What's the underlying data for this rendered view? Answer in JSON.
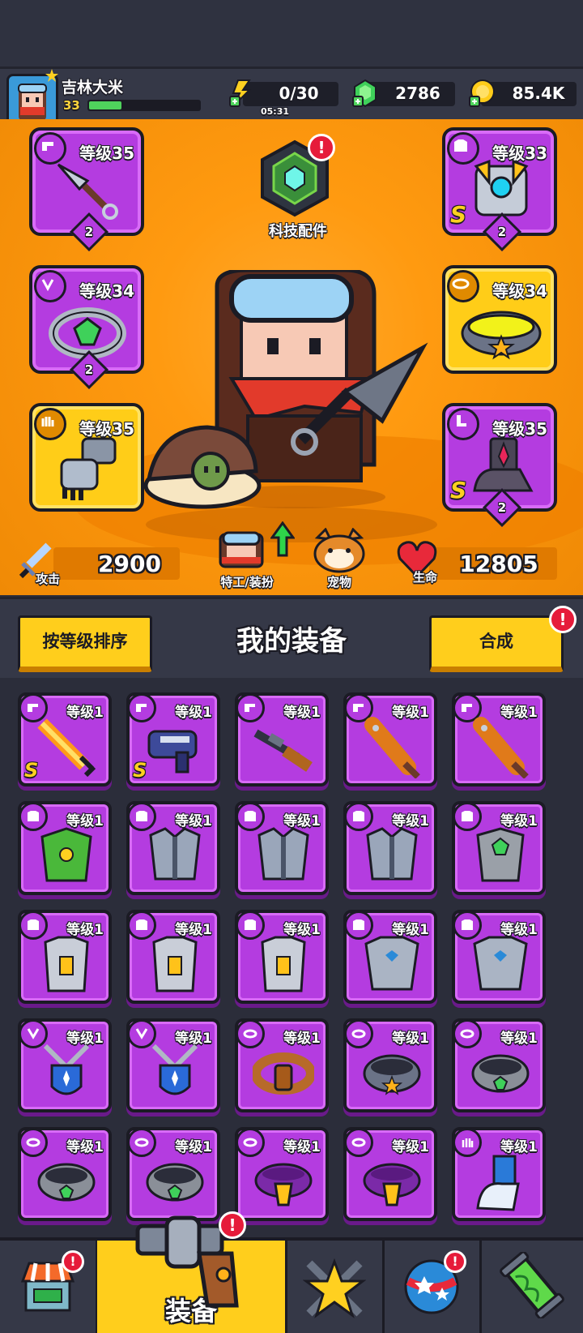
{
  "player": {
    "name": "吉林大米",
    "level": "33"
  },
  "resources": {
    "energy": "0/30",
    "energy_timer": "05:31",
    "gems": "2786",
    "coins": "85.4K"
  },
  "tech": {
    "label": "科技配件"
  },
  "slots": {
    "weapon": {
      "level": "等级35",
      "stars": "2"
    },
    "armor": {
      "level": "等级33",
      "stars": "2",
      "grade": "S"
    },
    "ring": {
      "level": "等级34",
      "stars": "2"
    },
    "belt": {
      "level": "等级34"
    },
    "gloves": {
      "level": "等级35"
    },
    "boots": {
      "level": "等级35",
      "stars": "2",
      "grade": "S"
    }
  },
  "stats": {
    "attack_label": "攻击",
    "attack": "2900",
    "hp_label": "生命",
    "hp": "12805",
    "agent_label": "特工/装扮",
    "pet_label": "宠物"
  },
  "equipment": {
    "title": "我的装备",
    "sort_button": "按等级排序",
    "merge_button": "合成",
    "items": [
      {
        "level": "等级1",
        "type": "weapon",
        "art": "sword",
        "grade": "S"
      },
      {
        "level": "等级1",
        "type": "weapon",
        "art": "blaster",
        "grade": "S"
      },
      {
        "level": "等级1",
        "type": "weapon",
        "art": "shotgun",
        "grade": ""
      },
      {
        "level": "等级1",
        "type": "weapon",
        "art": "bat",
        "grade": ""
      },
      {
        "level": "等级1",
        "type": "weapon",
        "art": "bat",
        "grade": ""
      },
      {
        "level": "等级1",
        "type": "armor",
        "art": "leaf-armor",
        "grade": ""
      },
      {
        "level": "等级1",
        "type": "armor",
        "art": "plate-armor",
        "grade": ""
      },
      {
        "level": "等级1",
        "type": "armor",
        "art": "plate-armor",
        "grade": ""
      },
      {
        "level": "等级1",
        "type": "armor",
        "art": "plate-armor",
        "grade": ""
      },
      {
        "level": "等级1",
        "type": "armor",
        "art": "gem-armor",
        "grade": ""
      },
      {
        "level": "等级1",
        "type": "armor",
        "art": "vest",
        "grade": ""
      },
      {
        "level": "等级1",
        "type": "armor",
        "art": "vest",
        "grade": ""
      },
      {
        "level": "等级1",
        "type": "armor",
        "art": "vest",
        "grade": ""
      },
      {
        "level": "等级1",
        "type": "armor",
        "art": "chestplate",
        "grade": ""
      },
      {
        "level": "等级1",
        "type": "armor",
        "art": "chestplate",
        "grade": ""
      },
      {
        "level": "等级1",
        "type": "necklace",
        "art": "shield-necklace",
        "grade": ""
      },
      {
        "level": "等级1",
        "type": "necklace",
        "art": "shield-necklace",
        "grade": ""
      },
      {
        "level": "等级1",
        "type": "belt",
        "art": "rope-belt",
        "grade": ""
      },
      {
        "level": "等级1",
        "type": "belt",
        "art": "star-belt",
        "grade": ""
      },
      {
        "level": "等级1",
        "type": "belt",
        "art": "gem-belt",
        "grade": ""
      },
      {
        "level": "等级1",
        "type": "belt",
        "art": "gem-belt",
        "grade": ""
      },
      {
        "level": "等级1",
        "type": "belt",
        "art": "gem-belt",
        "grade": ""
      },
      {
        "level": "等级1",
        "type": "belt",
        "art": "gold-belt",
        "grade": ""
      },
      {
        "level": "等级1",
        "type": "belt",
        "art": "gold-belt",
        "grade": ""
      },
      {
        "level": "等级1",
        "type": "gloves",
        "art": "fur-glove",
        "grade": ""
      }
    ]
  },
  "nav": {
    "equip_label": "装备"
  },
  "alert_mark": "!",
  "colors": {
    "rarity_purple": "#b43ce0",
    "rarity_gold": "#ffcd18",
    "accent_yellow": "#ffce1c",
    "alert_red": "#e61b3a"
  }
}
